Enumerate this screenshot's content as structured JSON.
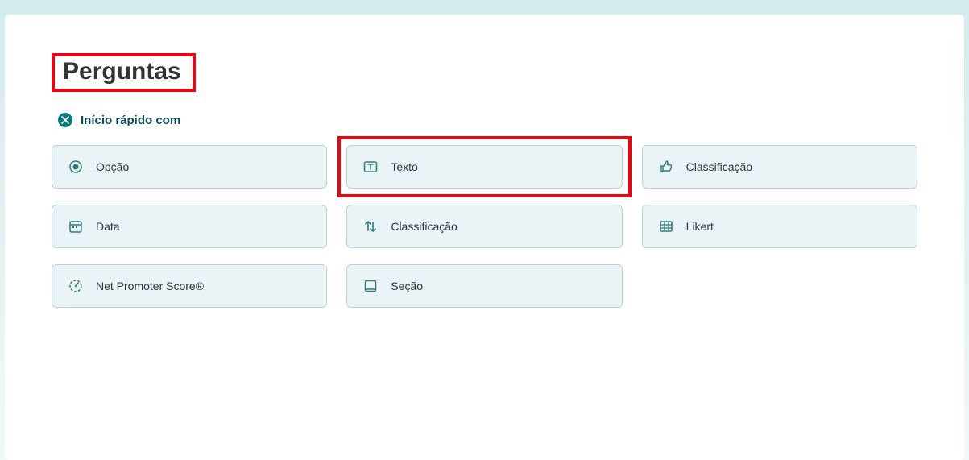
{
  "title": "Perguntas",
  "quickstart": {
    "label": "Início rápido com"
  },
  "options": [
    {
      "label": "Opção"
    },
    {
      "label": "Texto"
    },
    {
      "label": "Classificação"
    },
    {
      "label": "Data"
    },
    {
      "label": "Classificação"
    },
    {
      "label": "Likert"
    },
    {
      "label": "Net Promoter Score®"
    },
    {
      "label": "Seção"
    }
  ],
  "colors": {
    "highlight": "#e30613",
    "teal": "#087a7c",
    "tile_bg": "#eaf4f6",
    "tile_border": "#b6d4d8"
  }
}
